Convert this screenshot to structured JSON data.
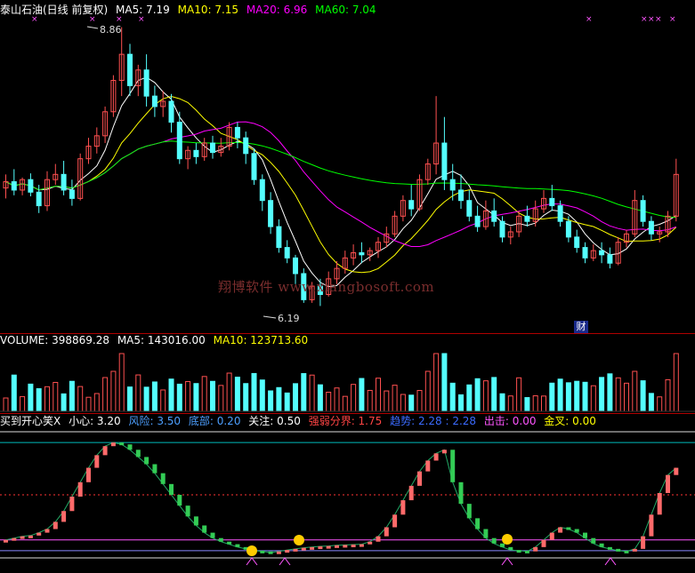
{
  "price_header": {
    "name": "泰山石油(日线 前复权)",
    "ma5": "MA5: 7.19",
    "ma10": "MA10: 7.15",
    "ma20": "MA20: 6.96",
    "ma60": "MA60: 7.04"
  },
  "volume_header": {
    "volume": "VOLUME: 398869.28",
    "ma5": "MA5: 143016.00",
    "ma10": "MA10: 123713.60"
  },
  "indicator_header": {
    "name": "买到开心笑X",
    "careful": "小心: 3.20",
    "risk": "风险: 3.50",
    "bottom": "底部: 0.20",
    "focus": "关注: 0.50",
    "boundary": "强弱分界: 1.75",
    "trend": "趋势: 2.28 : 2.28",
    "attack": "出击: 0.00",
    "cross": "金叉: 0.00"
  },
  "annotations": {
    "high": "8.86",
    "low": "6.19",
    "badge": "财"
  },
  "watermark": "翔博软件 www.xiangbosoft.com",
  "colors": {
    "up": "#ff5050",
    "down": "#54ffff",
    "ma5": "#ffffff",
    "ma10": "#ffff00",
    "ma20": "#ff00ff",
    "ma60": "#00ff00",
    "ind_up": "#ff6a6a",
    "ind_down": "#33cc55",
    "separator": "#b00000"
  },
  "chart_data": {
    "type": "candlestick",
    "ohlc": [
      [
        7.32,
        7.45,
        7.38,
        7.22
      ],
      [
        7.38,
        7.5,
        7.3,
        7.25
      ],
      [
        7.3,
        7.42,
        7.4,
        7.25
      ],
      [
        7.4,
        7.46,
        7.28,
        7.24
      ],
      [
        7.28,
        7.35,
        7.15,
        7.08
      ],
      [
        7.15,
        7.48,
        7.4,
        7.1
      ],
      [
        7.4,
        7.55,
        7.45,
        7.35
      ],
      [
        7.45,
        7.58,
        7.3,
        7.25
      ],
      [
        7.3,
        7.4,
        7.22,
        7.15
      ],
      [
        7.22,
        7.65,
        7.6,
        7.2
      ],
      [
        7.6,
        7.8,
        7.72,
        7.55
      ],
      [
        7.72,
        7.9,
        7.82,
        7.65
      ],
      [
        7.82,
        8.1,
        8.05,
        7.75
      ],
      [
        8.05,
        8.4,
        8.35,
        8.0
      ],
      [
        8.35,
        8.86,
        8.6,
        8.2
      ],
      [
        8.6,
        8.7,
        8.3,
        8.2
      ],
      [
        8.3,
        8.5,
        8.45,
        8.2
      ],
      [
        8.45,
        8.6,
        8.2,
        8.1
      ],
      [
        8.2,
        8.3,
        8.1,
        8.0
      ],
      [
        8.1,
        8.25,
        8.15,
        8.0
      ],
      [
        8.15,
        8.22,
        7.95,
        7.85
      ],
      [
        7.95,
        8.05,
        7.6,
        7.55
      ],
      [
        7.6,
        7.72,
        7.68,
        7.5
      ],
      [
        7.68,
        7.75,
        7.62,
        7.55
      ],
      [
        7.62,
        7.8,
        7.75,
        7.58
      ],
      [
        7.75,
        7.82,
        7.66,
        7.6
      ],
      [
        7.66,
        7.8,
        7.72,
        7.62
      ],
      [
        7.72,
        7.95,
        7.9,
        7.68
      ],
      [
        7.9,
        7.95,
        7.8,
        7.7
      ],
      [
        7.8,
        7.86,
        7.65,
        7.55
      ],
      [
        7.65,
        7.7,
        7.4,
        7.35
      ],
      [
        7.4,
        7.45,
        7.2,
        7.1
      ],
      [
        7.2,
        7.28,
        6.95,
        6.88
      ],
      [
        6.95,
        7.02,
        6.75,
        6.7
      ],
      [
        6.75,
        6.82,
        6.65,
        6.6
      ],
      [
        6.65,
        6.68,
        6.5,
        6.4
      ],
      [
        6.5,
        6.55,
        6.25,
        6.22
      ],
      [
        6.25,
        6.42,
        6.38,
        6.22
      ],
      [
        6.38,
        6.45,
        6.3,
        6.19
      ],
      [
        6.3,
        6.52,
        6.45,
        6.28
      ],
      [
        6.45,
        6.62,
        6.55,
        6.4
      ],
      [
        6.55,
        6.72,
        6.65,
        6.5
      ],
      [
        6.65,
        6.78,
        6.7,
        6.58
      ],
      [
        6.7,
        6.8,
        6.68,
        6.6
      ],
      [
        6.68,
        6.75,
        6.72,
        6.62
      ],
      [
        6.72,
        6.85,
        6.8,
        6.65
      ],
      [
        6.8,
        6.95,
        6.88,
        6.75
      ],
      [
        6.88,
        7.1,
        7.05,
        6.85
      ],
      [
        7.05,
        7.25,
        7.2,
        7.0
      ],
      [
        7.2,
        7.35,
        7.12,
        7.05
      ],
      [
        7.12,
        7.45,
        7.4,
        7.1
      ],
      [
        7.4,
        7.6,
        7.55,
        7.35
      ],
      [
        7.55,
        8.2,
        7.75,
        7.45
      ],
      [
        7.75,
        8.0,
        7.4,
        7.3
      ],
      [
        7.4,
        7.55,
        7.3,
        7.2
      ],
      [
        7.3,
        7.45,
        7.2,
        7.12
      ],
      [
        7.2,
        7.3,
        7.05,
        7.0
      ],
      [
        7.05,
        7.15,
        6.95,
        6.9
      ],
      [
        6.95,
        7.2,
        7.1,
        6.92
      ],
      [
        7.1,
        7.22,
        7.0,
        6.95
      ],
      [
        7.0,
        7.05,
        6.85,
        6.8
      ],
      [
        6.85,
        6.95,
        6.9,
        6.78
      ],
      [
        6.9,
        7.1,
        7.05,
        6.85
      ],
      [
        7.05,
        7.15,
        7.0,
        6.95
      ],
      [
        7.0,
        7.2,
        7.12,
        6.95
      ],
      [
        7.12,
        7.3,
        7.22,
        7.08
      ],
      [
        7.22,
        7.35,
        7.15,
        7.1
      ],
      [
        7.15,
        7.2,
        7.0,
        6.95
      ],
      [
        7.0,
        7.05,
        6.85,
        6.8
      ],
      [
        6.85,
        6.92,
        6.75,
        6.7
      ],
      [
        6.75,
        6.8,
        6.65,
        6.6
      ],
      [
        6.65,
        6.78,
        6.72,
        6.62
      ],
      [
        6.72,
        6.8,
        6.68,
        6.6
      ],
      [
        6.68,
        6.75,
        6.6,
        6.55
      ],
      [
        6.6,
        6.85,
        6.8,
        6.58
      ],
      [
        6.8,
        6.92,
        6.88,
        6.75
      ],
      [
        6.88,
        7.3,
        7.2,
        6.85
      ],
      [
        7.2,
        7.25,
        7.0,
        6.95
      ],
      [
        7.0,
        7.05,
        6.88,
        6.82
      ],
      [
        6.88,
        6.95,
        6.9,
        6.8
      ],
      [
        6.9,
        7.1,
        7.05,
        6.85
      ],
      [
        7.05,
        7.6,
        7.45,
        7.0
      ]
    ],
    "volume_count": 82,
    "indicator_values": [
      0.5,
      0.55,
      0.6,
      0.62,
      0.7,
      0.8,
      1.0,
      1.3,
      1.7,
      2.1,
      2.5,
      2.85,
      3.1,
      3.2,
      3.15,
      3.0,
      2.8,
      2.6,
      2.35,
      2.05,
      1.75,
      1.45,
      1.15,
      0.9,
      0.7,
      0.55,
      0.45,
      0.38,
      0.3,
      0.25,
      0.2,
      0.18,
      0.15,
      0.18,
      0.22,
      0.25,
      0.28,
      0.3,
      0.32,
      0.33,
      0.35,
      0.36,
      0.37,
      0.38,
      0.45,
      0.6,
      0.85,
      1.2,
      1.6,
      2.0,
      2.4,
      2.7,
      2.9,
      3.0,
      2.1,
      1.5,
      1.1,
      0.8,
      0.55,
      0.4,
      0.3,
      0.22,
      0.2,
      0.18,
      0.3,
      0.5,
      0.7,
      0.85,
      0.8,
      0.7,
      0.55,
      0.4,
      0.3,
      0.25,
      0.2,
      0.18,
      0.25,
      0.6,
      1.2,
      1.8,
      2.3,
      2.5
    ]
  }
}
